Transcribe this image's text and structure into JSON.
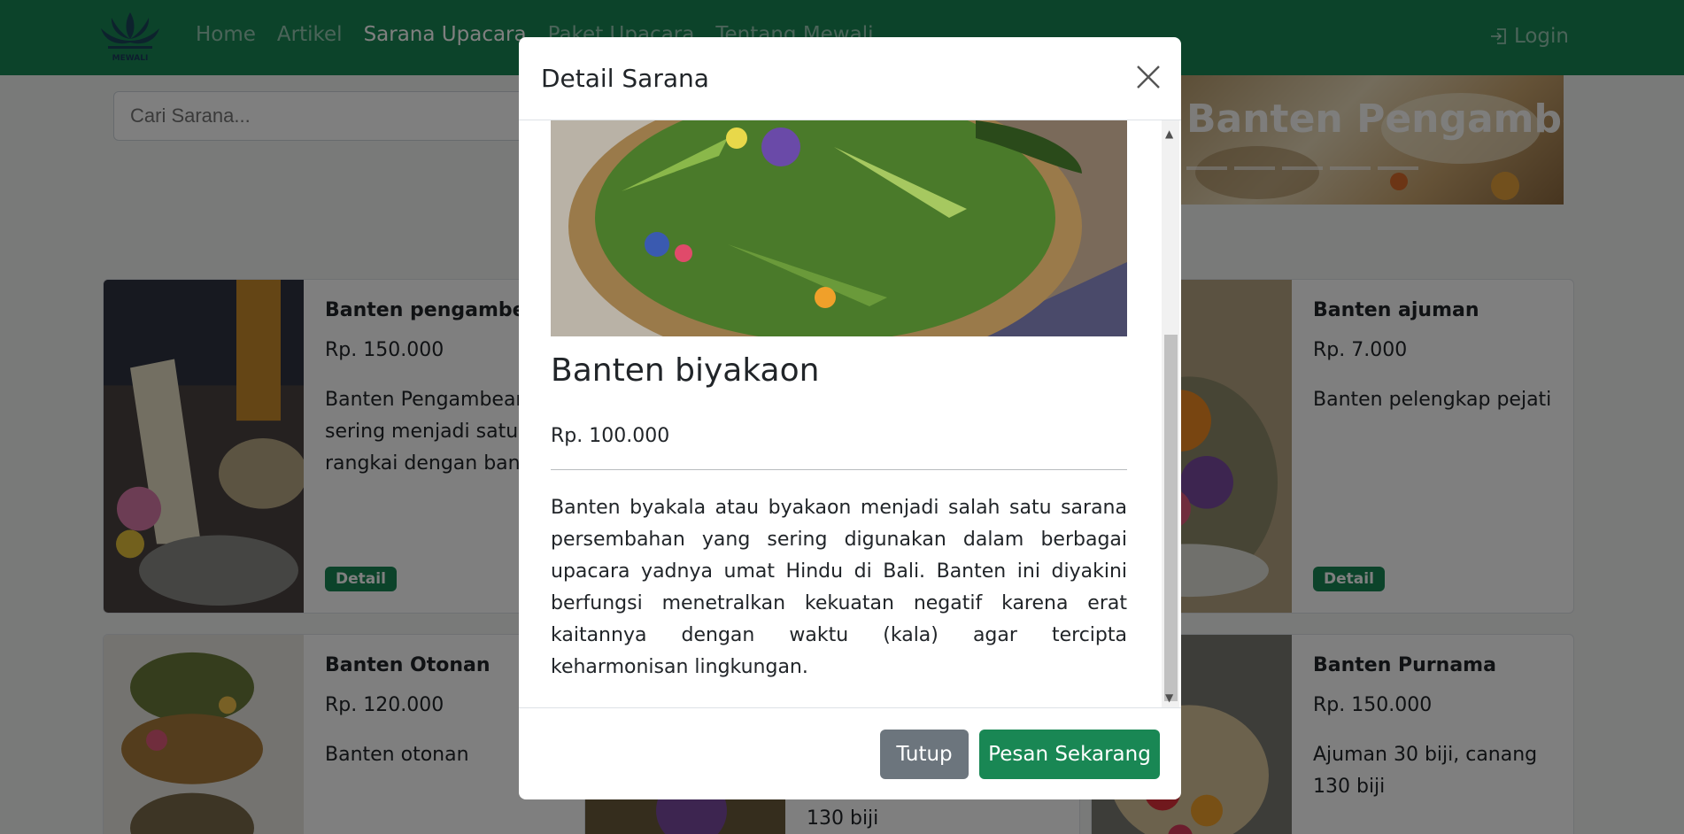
{
  "nav": {
    "links": [
      "Home",
      "Artikel",
      "Sarana Upacara",
      "Paket Upacara",
      "Tentang Mewali"
    ],
    "login": "Login",
    "logo_text": "MEWALI"
  },
  "search": {
    "placeholder": "Cari Sarana..."
  },
  "carousel": {
    "caption": "Banten Pengambean"
  },
  "cards": [
    {
      "title": "Banten pengambean",
      "price": "Rp. 150.000",
      "desc": "Banten Pengambean sering menjadi satu rangkai dengan banten",
      "button": "Detail"
    },
    {
      "title": "Banten ajuman",
      "price": "Rp. 7.000",
      "desc": "Banten pelengkap pejati",
      "button": "Detail"
    },
    {
      "title": "Banten Otonan",
      "price": "Rp. 120.000",
      "desc": "Banten otonan"
    },
    {
      "title": "Banten Purnama",
      "price": "Rp. 150.000",
      "desc": "Ajuman 30 biji, canang 130 biji"
    }
  ],
  "card_middle_partial": "130 biji",
  "modal": {
    "title": "Detail Sarana",
    "item_name": "Banten biyakaon",
    "item_price": "Rp. 100.000",
    "item_desc": "Banten byakala atau byakaon menjadi salah satu sarana persembahan yang sering digunakan dalam berbagai upacara yadnya umat Hindu di Bali. Banten ini diyakini berfungsi menetralkan kekuatan negatif karena erat kaitannya dengan waktu (kala) agar tercipta keharmonisan lingkungan.",
    "close_label": "Tutup",
    "order_label": "Pesan Sekarang"
  },
  "colors": {
    "primary": "#198754",
    "secondary": "#6c757d"
  }
}
